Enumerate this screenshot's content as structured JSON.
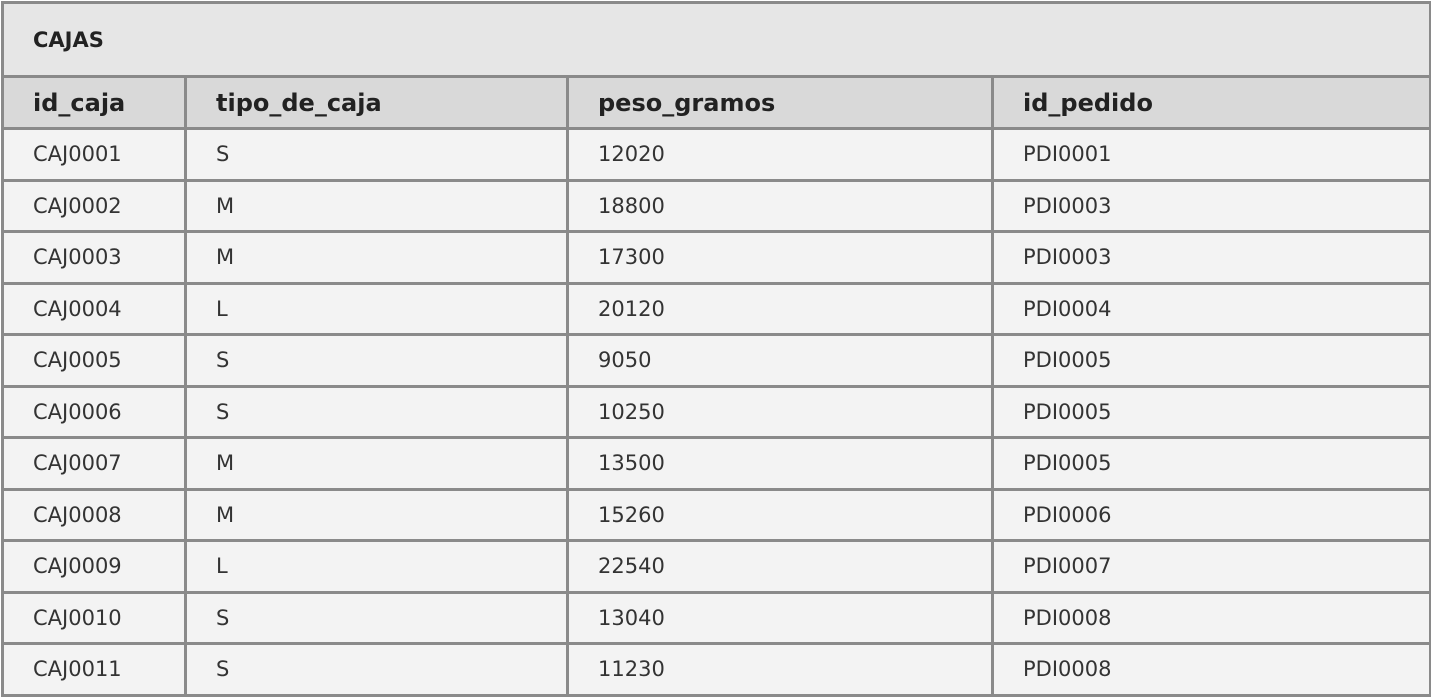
{
  "table": {
    "title": "CAJAS",
    "columns": [
      "id_caja",
      "tipo_de_caja",
      "peso_gramos",
      "id_pedido"
    ],
    "rows": [
      [
        "CAJ0001",
        "S",
        "12020",
        "PDI0001"
      ],
      [
        "CAJ0002",
        "M",
        "18800",
        "PDI0003"
      ],
      [
        "CAJ0003",
        "M",
        "17300",
        "PDI0003"
      ],
      [
        "CAJ0004",
        "L",
        "20120",
        "PDI0004"
      ],
      [
        "CAJ0005",
        "S",
        "9050",
        "PDI0005"
      ],
      [
        "CAJ0006",
        "S",
        "10250",
        "PDI0005"
      ],
      [
        "CAJ0007",
        "M",
        "13500",
        "PDI0005"
      ],
      [
        "CAJ0008",
        "M",
        "15260",
        "PDI0006"
      ],
      [
        "CAJ0009",
        "L",
        "22540",
        "PDI0007"
      ],
      [
        "CAJ0010",
        "S",
        "13040",
        "PDI0008"
      ],
      [
        "CAJ0011",
        "S",
        "11230",
        "PDI0008"
      ]
    ]
  }
}
